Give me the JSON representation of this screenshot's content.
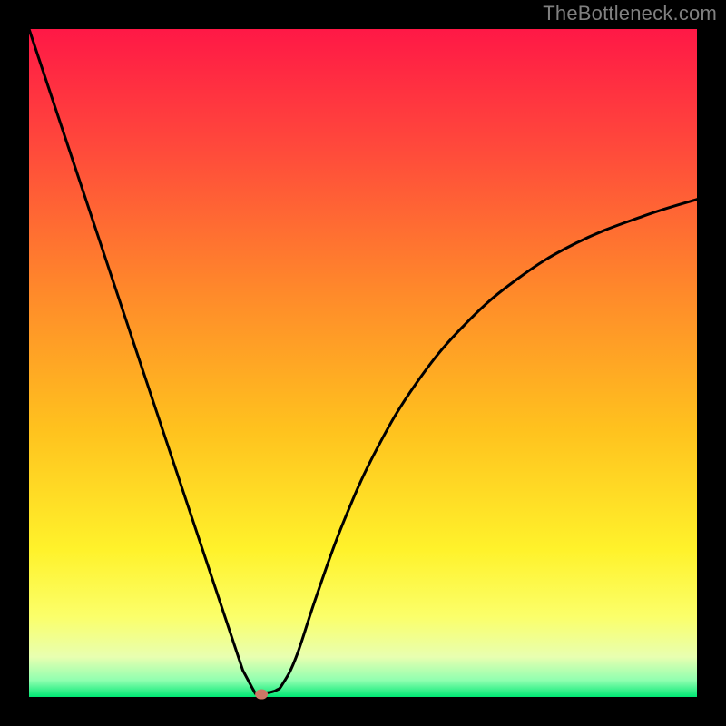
{
  "watermark": "TheBottleneck.com",
  "chart_data": {
    "type": "line",
    "title": "",
    "xlabel": "",
    "ylabel": "",
    "xlim": [
      0,
      100
    ],
    "ylim": [
      0,
      100
    ],
    "x": [
      0,
      3,
      6,
      9,
      12,
      15,
      18,
      21,
      24,
      27,
      30,
      32,
      33.5,
      34.5,
      35.5,
      37,
      38,
      40,
      43,
      47,
      52,
      58,
      65,
      73,
      82,
      92,
      100
    ],
    "y": [
      100,
      91,
      82,
      73,
      64,
      55,
      46,
      37,
      28,
      19,
      10,
      4,
      1.2,
      0.5,
      0.6,
      1,
      2,
      6,
      15,
      26,
      37,
      47,
      55.5,
      62.5,
      68,
      72,
      74.5
    ],
    "notch_x": 34.5,
    "marker": {
      "x": 34.8,
      "y": 0.4,
      "color": "#cc7766"
    },
    "gradient_stops": [
      {
        "offset": 0.0,
        "color": "#ff1846"
      },
      {
        "offset": 0.18,
        "color": "#ff4a3b"
      },
      {
        "offset": 0.4,
        "color": "#ff8b2a"
      },
      {
        "offset": 0.6,
        "color": "#ffc21e"
      },
      {
        "offset": 0.78,
        "color": "#fff22b"
      },
      {
        "offset": 0.88,
        "color": "#fbff6a"
      },
      {
        "offset": 0.94,
        "color": "#e8ffb0"
      },
      {
        "offset": 0.975,
        "color": "#90ffb0"
      },
      {
        "offset": 1.0,
        "color": "#00e874"
      }
    ],
    "plot_bg_black_border_px": 32,
    "curve_stroke": "#000000",
    "curve_stroke_width": 3
  }
}
